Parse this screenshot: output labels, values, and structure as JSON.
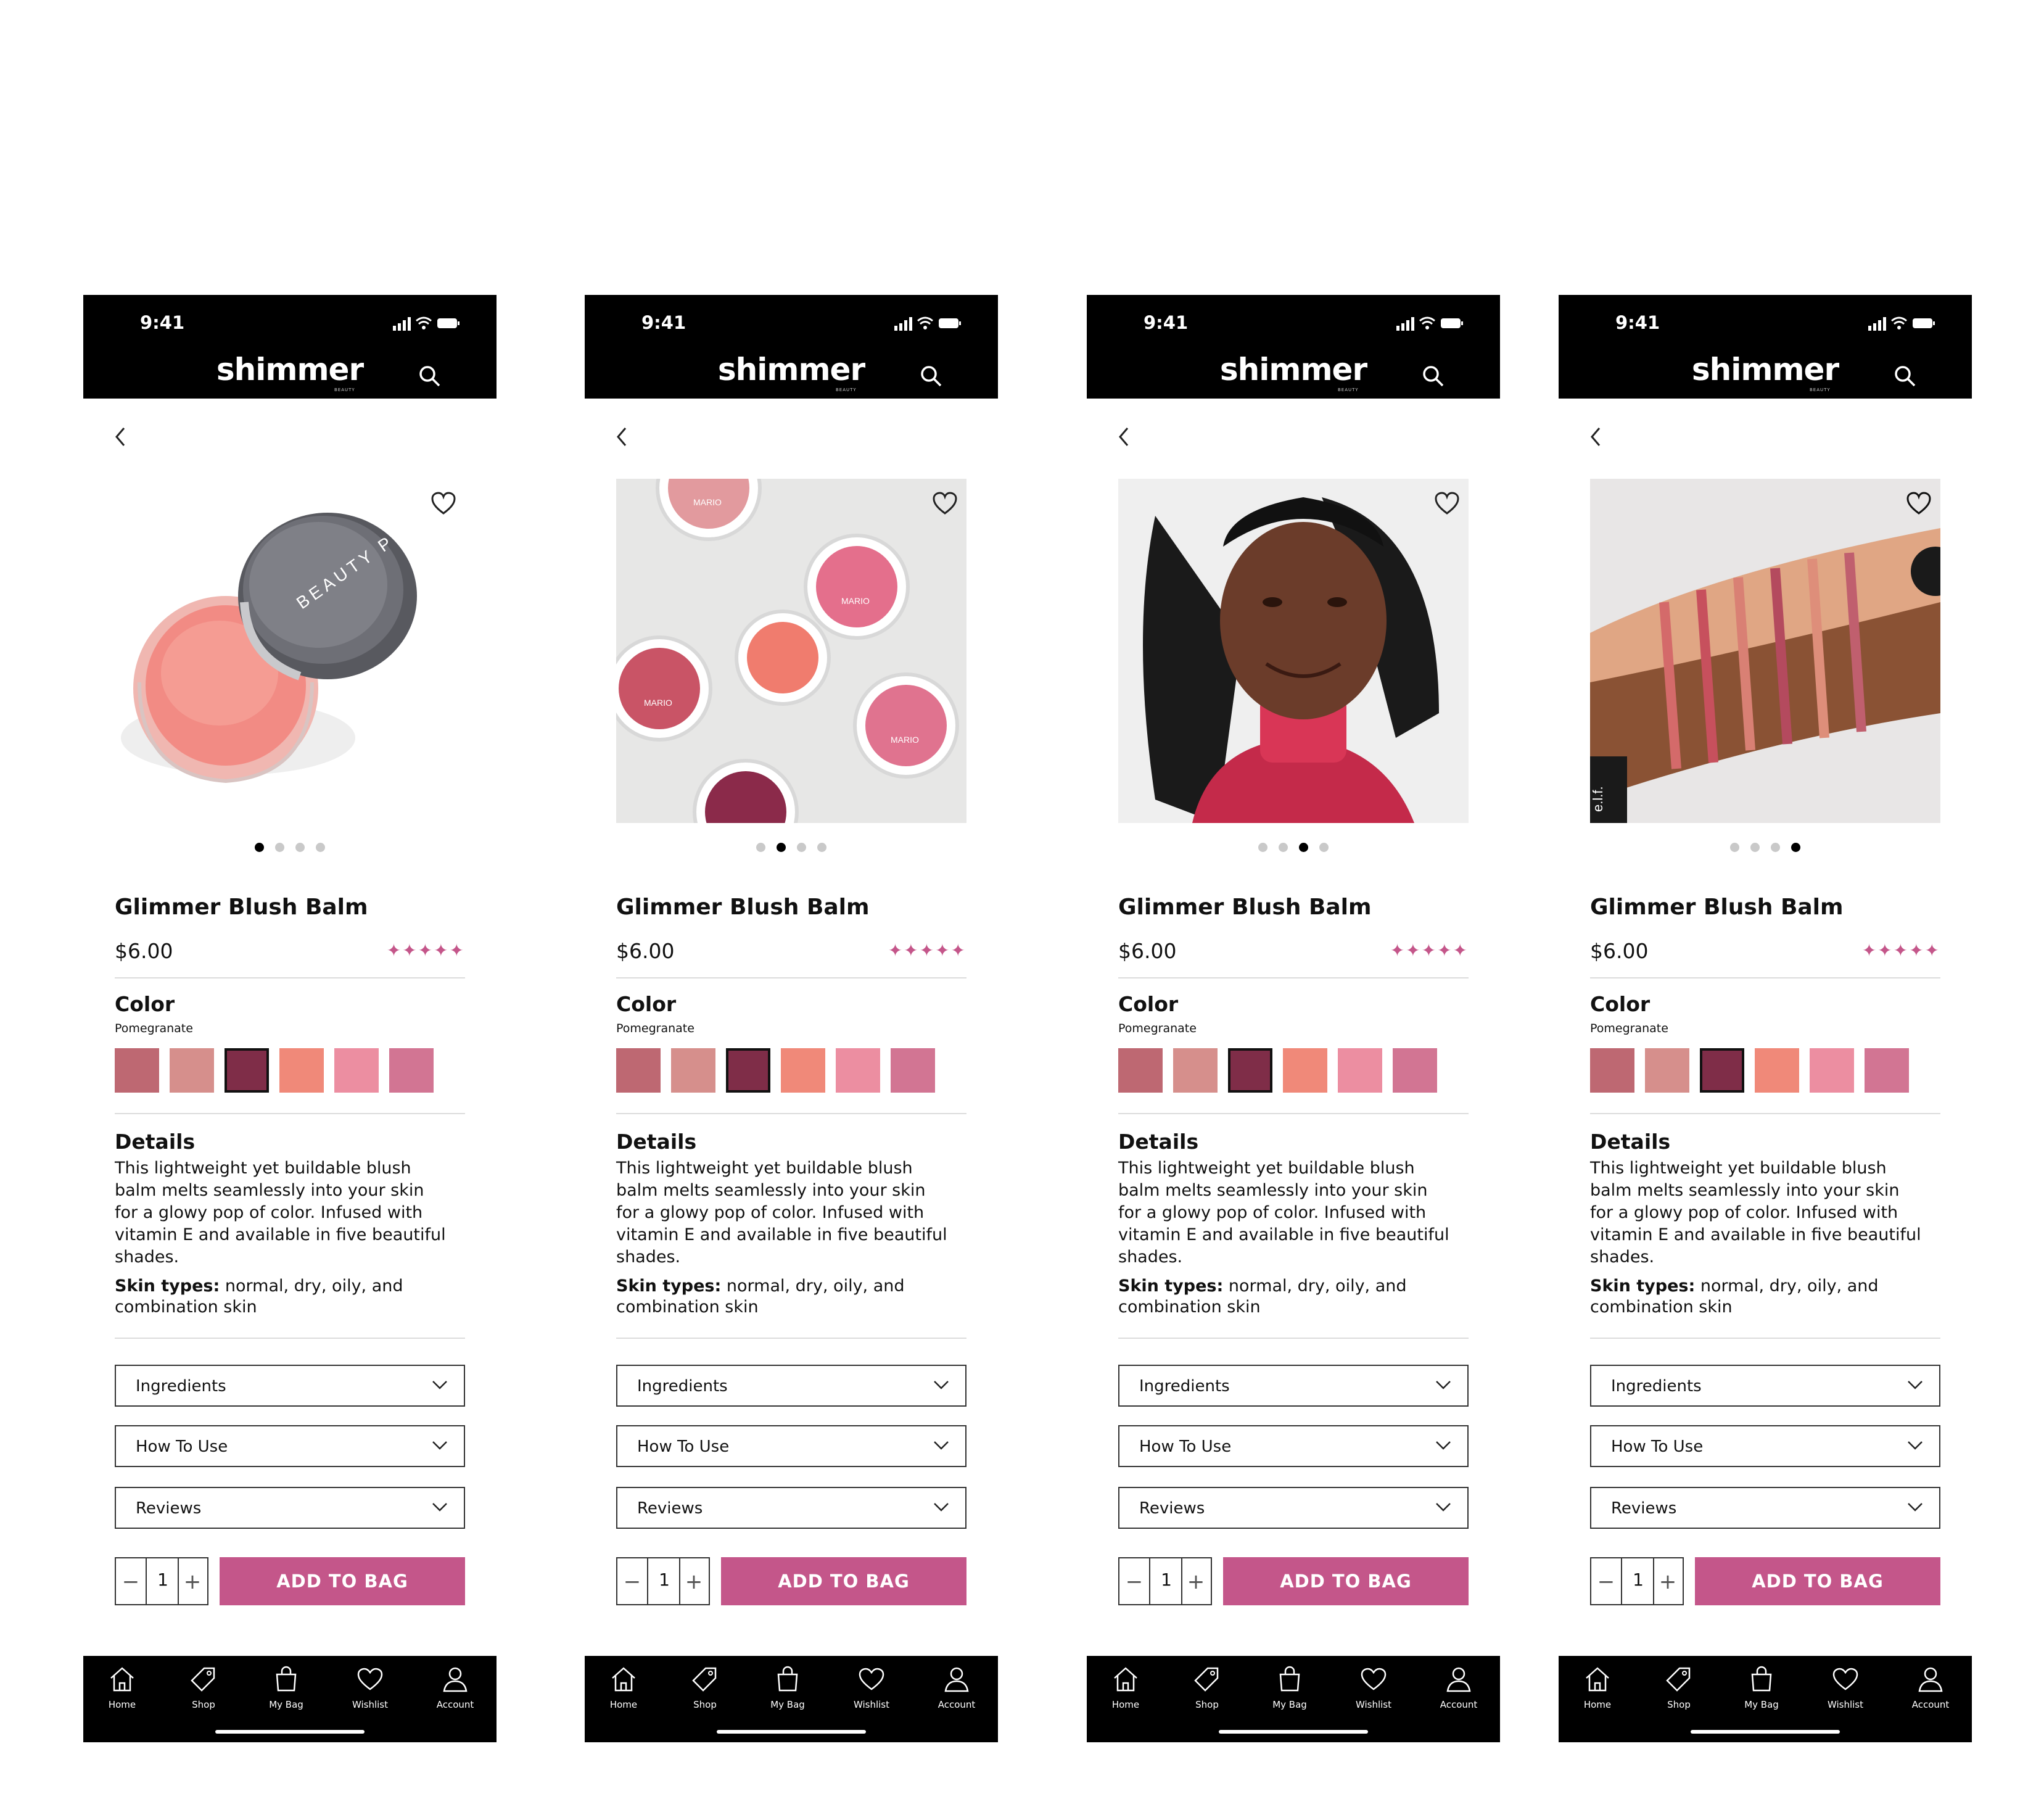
{
  "status_bar": {
    "time": "9:41"
  },
  "header": {
    "brand": "shimmer",
    "brand_sub": "BEAUTY",
    "search_icon": "search-icon"
  },
  "product": {
    "name": "Glimmer Blush Balm",
    "price": "$6.00",
    "rating": 5,
    "rating_stars": "✦✦✦✦✦",
    "color_label": "Color",
    "selected_color": "Pomegranate",
    "swatch_colors": [
      "#be6872",
      "#d68f8c",
      "#7f2d48",
      "#f08979",
      "#ec8ea1",
      "#d27593"
    ],
    "details_heading": "Details",
    "details_text": "This lightweight yet buildable blush balm melts seamlessly into your skin for a glowy pop of color. Infused with vitamin E and available in five beautiful shades.",
    "skin_types_label": "Skin types:",
    "skin_types_value": "normal, dry, oily, and combination skin"
  },
  "accordion": [
    "Ingredients",
    "How To Use",
    "Reviews"
  ],
  "purchase": {
    "quantity": "1",
    "minus": "−",
    "plus": "+",
    "add_to_bag": "ADD TO BAG"
  },
  "tabbar": [
    {
      "label": "Home",
      "icon": "home-icon"
    },
    {
      "label": "Shop",
      "icon": "tag-icon"
    },
    {
      "label": "My Bag",
      "icon": "bag-icon"
    },
    {
      "label": "Wishlist",
      "icon": "heart-icon"
    },
    {
      "label": "Account",
      "icon": "user-icon"
    }
  ],
  "screens": [
    {
      "active_image_index": 0,
      "image_subject": "blush balm jar",
      "jar_text": "BEAUTY PIE"
    },
    {
      "active_image_index": 1,
      "image_subject": "blush compacts",
      "compact_text": "MARIO"
    },
    {
      "active_image_index": 2,
      "image_subject": "model portrait"
    },
    {
      "active_image_index": 3,
      "image_subject": "arm swatches",
      "tube_text": "e.l.f."
    }
  ],
  "colors": {
    "accent": "#c4568a",
    "bar": "#000000"
  }
}
